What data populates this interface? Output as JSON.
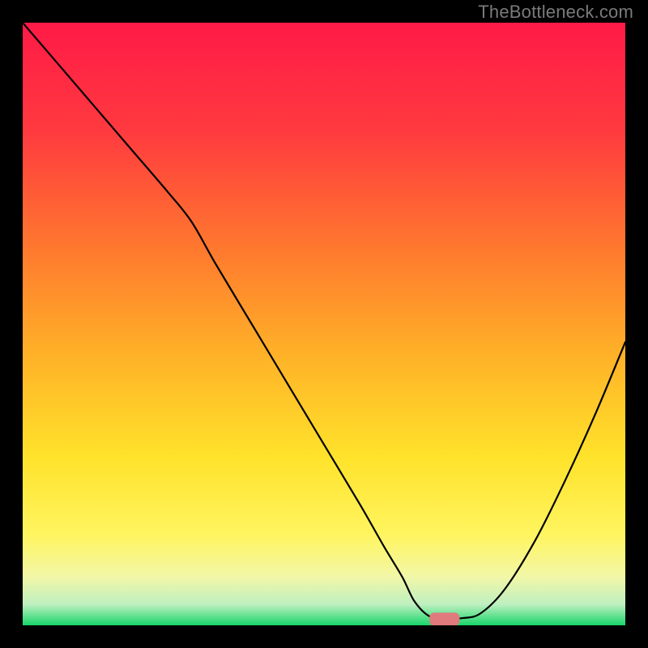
{
  "watermark": "TheBottleneck.com",
  "chart_data": {
    "type": "line",
    "title": "",
    "xlabel": "",
    "ylabel": "",
    "xlim": [
      0,
      100
    ],
    "ylim": [
      0,
      100
    ],
    "grid": false,
    "legend": false,
    "background_gradient_stops": [
      {
        "offset": 0.0,
        "color": "#ff1a47"
      },
      {
        "offset": 0.18,
        "color": "#ff3a3f"
      },
      {
        "offset": 0.38,
        "color": "#ff7a2e"
      },
      {
        "offset": 0.55,
        "color": "#ffb128"
      },
      {
        "offset": 0.72,
        "color": "#ffe22a"
      },
      {
        "offset": 0.85,
        "color": "#fff560"
      },
      {
        "offset": 0.92,
        "color": "#f2f7a8"
      },
      {
        "offset": 0.965,
        "color": "#bff0c0"
      },
      {
        "offset": 1.0,
        "color": "#18d66a"
      }
    ],
    "series": [
      {
        "name": "bottleneck-curve",
        "color": "#000000",
        "width": 2.2,
        "x": [
          0,
          6,
          12,
          18,
          24,
          28,
          32,
          38,
          44,
          50,
          56,
          60,
          63,
          65,
          67.5,
          70,
          73,
          76,
          80,
          85,
          90,
          95,
          100
        ],
        "y": [
          100,
          93,
          86,
          79,
          72,
          67,
          60,
          50,
          40,
          30,
          20,
          13,
          8,
          4,
          1.5,
          1.2,
          1.2,
          2,
          6,
          14,
          24,
          35,
          47
        ]
      }
    ],
    "marker": {
      "name": "optimal-marker",
      "shape": "rounded-rect",
      "color": "#e07a7d",
      "x": 70,
      "y": 1.0,
      "width": 5.0,
      "height": 2.2
    }
  }
}
